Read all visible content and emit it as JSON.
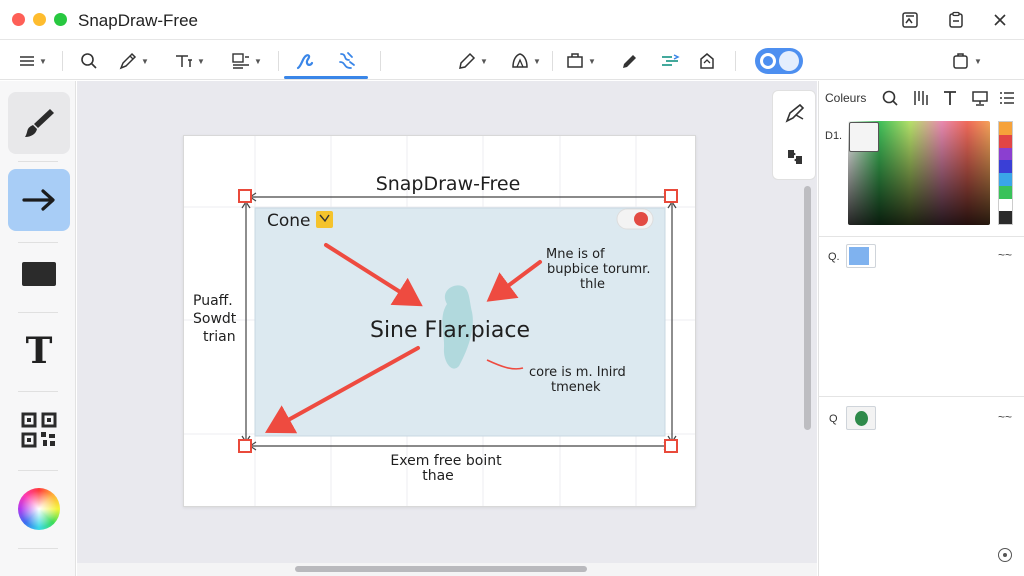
{
  "window": {
    "title": "SnapDraw-Free",
    "lights": [
      "#fe5f57",
      "#febc2e",
      "#28c840"
    ]
  },
  "toolbar": {
    "icons": [
      "menu-icon",
      "search-icon",
      "pen-icon",
      "text-format-icon",
      "layout-icon",
      "brush-alt-icon",
      "sparkle-icon",
      "pencil-icon",
      "shape-icon",
      "frame-icon",
      "edit-icon",
      "align-icon",
      "stamp-icon",
      "clipboard-icon"
    ],
    "toggle_on": true
  },
  "tools": [
    "brush-icon",
    "arrow-icon",
    "rectangle-icon",
    "text-tool-icon",
    "qr-icon",
    "color-wheel-icon"
  ],
  "tools_text_glyph": "T",
  "canvas": {
    "title": "SnapDraw-Free",
    "label_cone": "Cone",
    "center_text": "Sine Flar.piace",
    "note_top_right": [
      "Mne is of",
      "bupbice torumr.",
      "thle"
    ],
    "note_bottom_right": [
      "core is m. Inird",
      "tmenek"
    ],
    "note_left": [
      "Puaff.",
      "Sowdt",
      "trian"
    ],
    "note_bottom": [
      "Exem free boint",
      "thae"
    ]
  },
  "right_panel": {
    "title": "Coleurs",
    "swatch_label": "D1.",
    "layers": [
      {
        "label": "Q.",
        "color": "#7fb2ef"
      },
      {
        "label": "Q",
        "color": "#2e8a4a"
      }
    ],
    "layer_menu_glyph": "~~",
    "hue_colors": [
      "#f6a23a",
      "#e24545",
      "#8b3fd0",
      "#3a3fd6",
      "#3aa5e8",
      "#39c25a",
      "#ffffff",
      "#2b2b2b"
    ]
  },
  "colors": {
    "accent": "#3a86e8",
    "arrow": "#ee4b40",
    "handle": "#e94a3b"
  }
}
